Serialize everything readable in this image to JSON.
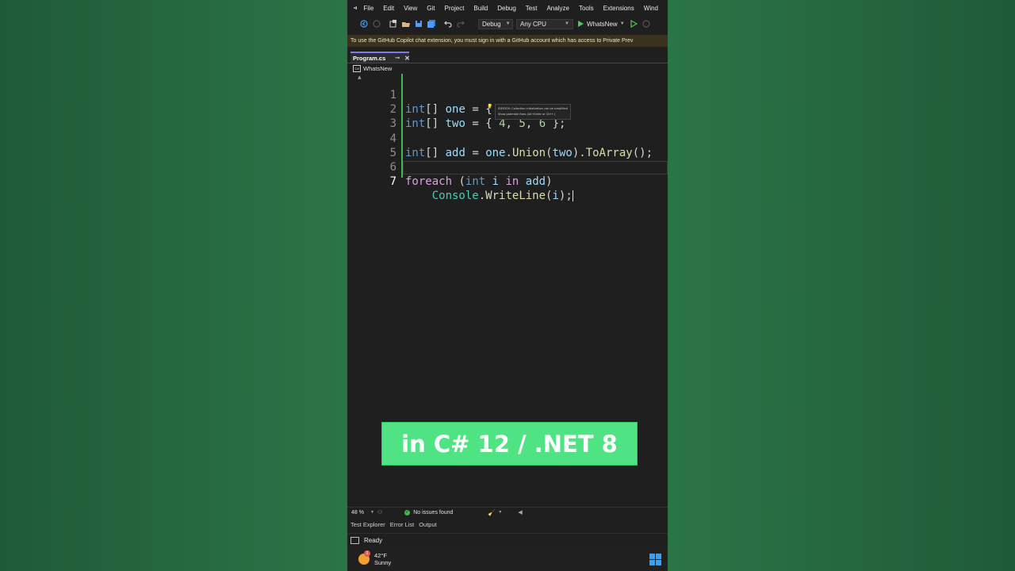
{
  "menu": {
    "items": [
      "File",
      "Edit",
      "View",
      "Git",
      "Project",
      "Build",
      "Debug",
      "Test",
      "Analyze",
      "Tools",
      "Extensions",
      "Wind"
    ]
  },
  "toolbar": {
    "config": "Debug",
    "platform": "Any CPU",
    "run_target": "WhatsNew"
  },
  "infobar": {
    "message": "To use the GitHub Copilot chat extension, you must sign in with a GitHub account which has access to Private Prev"
  },
  "tab": {
    "filename": "Program.cs",
    "pin_glyph": "⊸",
    "close_glyph": "✕"
  },
  "navbar": {
    "project": "WhatsNew"
  },
  "editor": {
    "lines": [
      {
        "number": "1"
      },
      {
        "number": "2"
      },
      {
        "number": "3"
      },
      {
        "number": "4"
      },
      {
        "number": "5"
      },
      {
        "number": "6"
      },
      {
        "number": "7"
      }
    ],
    "tokens": {
      "int": "int",
      "brackets": "[]",
      "one": "one",
      "two": "two",
      "add": "add",
      "eq": "=",
      "lbrace": "{",
      "rbrace": "};",
      "n1": "1",
      "n2": "2",
      "n3": "3",
      "n4": "4",
      "n5": "5",
      "n6": "6",
      "comma": ",",
      "dot": ".",
      "union": "Union",
      "lparen": "(",
      "rparen": ")",
      "toarray": "ToArray",
      "endcall": "();",
      "foreach": "foreach",
      "i": "i",
      "in": "in",
      "console": "Console",
      "writeline": "WriteLine",
      "endstmt": ");"
    },
    "tooltip": {
      "line1": "IDE0300: Collection initialization can be simplified",
      "line2": "Show potential fixes (Alt+Enter or Ctrl+.)"
    }
  },
  "banner": {
    "text": "in C# 12 / .NET 8"
  },
  "status": {
    "zoom": "48 %",
    "issues": "No issues found",
    "ready": "Ready"
  },
  "toolwindows": [
    "Test Explorer",
    "Error List",
    "Output"
  ],
  "weather": {
    "temp": "42°F",
    "condition": "Sunny",
    "badge": "1"
  },
  "colors": {
    "banner_bg": "#4fe383",
    "keyword": "#569cd6",
    "control_keyword": "#d8a0df",
    "variable": "#9cdcfe",
    "number": "#b5cea8",
    "method": "#dcdcaa",
    "type": "#4ec9b0"
  }
}
